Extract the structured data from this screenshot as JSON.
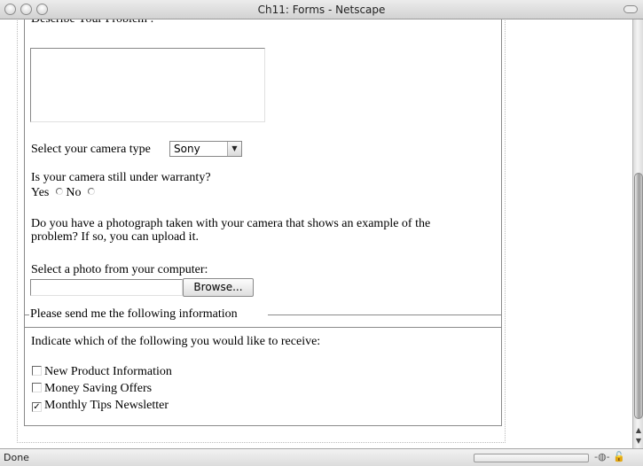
{
  "window": {
    "title": "Ch11: Forms - Netscape"
  },
  "problem": {
    "label": "Describe Your Problem :",
    "value": ""
  },
  "camera": {
    "label": "Select your camera type",
    "selected": "Sony"
  },
  "warranty": {
    "question": "Is your camera still under warranty?",
    "yes_label": "Yes",
    "no_label": "No"
  },
  "photo": {
    "question_line1": "Do you have a photograph taken with your camera that shows an example of the",
    "question_line2": "problem? If so, you can upload it.",
    "select_label": "Select a photo from your computer:",
    "file_value": "",
    "browse_label": "Browse..."
  },
  "info": {
    "legend": "Please send me the following information",
    "instruction": "Indicate which of the following you would like to receive:",
    "options": [
      {
        "label": "New Product Information",
        "checked": false
      },
      {
        "label": "Money Saving Offers",
        "checked": false
      },
      {
        "label": "Monthly Tips Newsletter",
        "checked": true
      }
    ]
  },
  "statusbar": {
    "status": "Done"
  }
}
